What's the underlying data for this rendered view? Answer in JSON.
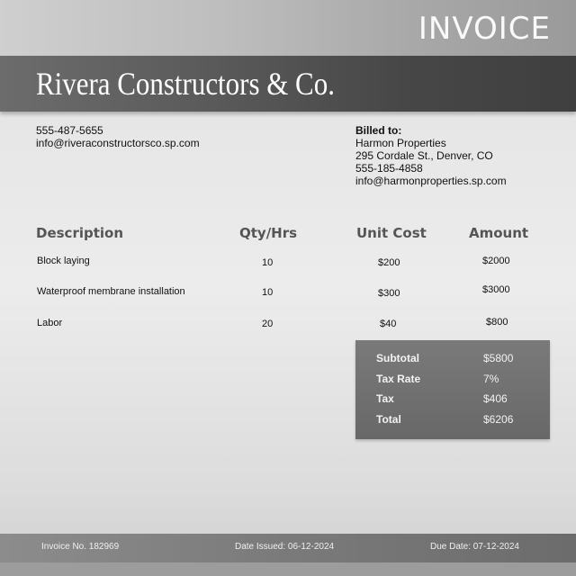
{
  "header": {
    "title": "INVOICE",
    "company_name": "Rivera Constructors & Co."
  },
  "company_contact": {
    "phone": "555-487-5655",
    "email": "info@riveraconstructorsco.sp.com"
  },
  "billed_to": {
    "label": "Billed to:",
    "name": "Harmon Properties",
    "address": "295 Cordale St., Denver, CO",
    "phone": "555-185-4858",
    "email": "info@harmonproperties.sp.com"
  },
  "table": {
    "headers": {
      "description": "Description",
      "qty": "Qty/Hrs",
      "unit_cost": "Unit Cost",
      "amount": "Amount"
    },
    "rows": [
      {
        "description": "Block laying",
        "qty": "10",
        "unit_cost": "$200",
        "amount": "$2000"
      },
      {
        "description": "Waterproof membrane installation",
        "qty": "10",
        "unit_cost": "$300",
        "amount": "$3000"
      },
      {
        "description": "Labor",
        "qty": "20",
        "unit_cost": "$40",
        "amount": "$800"
      }
    ]
  },
  "summary": {
    "subtotal_label": "Subtotal",
    "subtotal_value": "$5800",
    "tax_rate_label": "Tax Rate",
    "tax_rate_value": "7%",
    "tax_label": "Tax",
    "tax_value": "$406",
    "total_label": "Total",
    "total_value": "$6206"
  },
  "footer": {
    "invoice_no": "Invoice No. 182969",
    "date_issued": "Date Issued: 06-12-2024",
    "due_date": "Due Date: 07-12-2024"
  }
}
